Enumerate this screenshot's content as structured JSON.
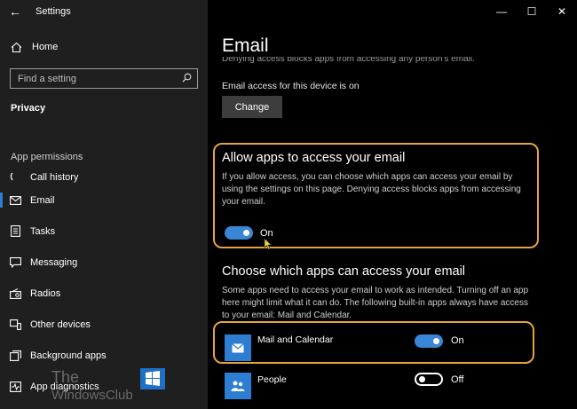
{
  "window": {
    "title": "Settings",
    "back_icon": "back-arrow-icon",
    "controls": {
      "minimize": "—",
      "maximize": "☐",
      "close": "✕"
    }
  },
  "sidebar": {
    "home_label": "Home",
    "search_placeholder": "Find a setting",
    "section_title": "Privacy",
    "group_title": "App permissions",
    "items": [
      {
        "label": "Call history",
        "icon": "call-history-icon"
      },
      {
        "label": "Email",
        "icon": "envelope-icon",
        "active": true
      },
      {
        "label": "Tasks",
        "icon": "tasks-icon"
      },
      {
        "label": "Messaging",
        "icon": "chat-icon"
      },
      {
        "label": "Radios",
        "icon": "radio-icon"
      },
      {
        "label": "Other devices",
        "icon": "devices-icon"
      },
      {
        "label": "Background apps",
        "icon": "background-apps-icon"
      },
      {
        "label": "App diagnostics",
        "icon": "diagnostics-icon"
      }
    ],
    "watermark": {
      "line1": "The",
      "line2": "WindowsClub"
    }
  },
  "main": {
    "page_title": "Email",
    "cut_off_text": "Denying access blocks apps from accessing any person's email.",
    "device_status": "Email access for this device is on",
    "change_button": "Change",
    "allow_section": {
      "heading": "Allow apps to access your email",
      "description": "If you allow access, you can choose which apps can access your email by using the settings on this page. Denying access blocks apps from accessing your email.",
      "toggle_state": "On"
    },
    "choose_section": {
      "heading": "Choose which apps can access your email",
      "description": "Some apps need to access your email to work as intended. Turning off an app here might limit what it can do. The following built-in apps always have access to your email: Mail and Calendar."
    },
    "apps": [
      {
        "name": "Mail and Calendar",
        "icon": "mail-calendar-icon",
        "state": "On"
      },
      {
        "name": "People",
        "icon": "people-icon",
        "state": "Off"
      }
    ]
  },
  "colors": {
    "accent": "#3a86d6",
    "highlight": "#e6a33c",
    "sidebar_bg": "#1f1f1f",
    "main_bg": "#000000"
  }
}
